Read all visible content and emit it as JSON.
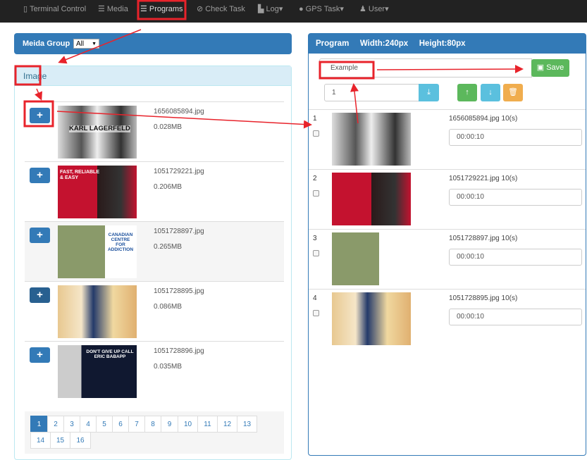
{
  "nav": {
    "items": [
      {
        "label": "Terminal Control",
        "icon": "mobile-icon"
      },
      {
        "label": "Media",
        "icon": "list-icon"
      },
      {
        "label": "Programs",
        "icon": "list-icon"
      },
      {
        "label": "Check Task",
        "icon": "check-circle-icon"
      },
      {
        "label": "Log▾",
        "icon": "file-icon"
      },
      {
        "label": "GPS Task▾",
        "icon": "globe-icon"
      },
      {
        "label": "User▾",
        "icon": "user-icon"
      }
    ]
  },
  "media": {
    "group_label": "Meida Group",
    "group_value": "All",
    "panel_title": "Image",
    "items": [
      {
        "file": "1656085894.jpg",
        "size": "0.028MB",
        "thumb_text": "KARL LAGERFELD"
      },
      {
        "file": "1051729221.jpg",
        "size": "0.206MB",
        "thumb_text": "FAST, RELIABLE & EASY"
      },
      {
        "file": "1051728897.jpg",
        "size": "0.265MB",
        "thumb_text": "CANADIAN CENTRE FOR ADDICTION"
      },
      {
        "file": "1051728895.jpg",
        "size": "0.086MB"
      },
      {
        "file": "1051728896.jpg",
        "size": "0.035MB",
        "thumb_text": "DON'T GIVE UP CALL ERIC BABAPP"
      }
    ],
    "pages": [
      "1",
      "2",
      "3",
      "4",
      "5",
      "6",
      "7",
      "8",
      "9",
      "10",
      "11",
      "12",
      "13",
      "14",
      "15",
      "16"
    ],
    "current_page": "1"
  },
  "program": {
    "title": "Program",
    "width": "Width:240px",
    "height": "Height:80px",
    "name_value": "Example",
    "save_label": "Save",
    "index_value": "1",
    "items": [
      {
        "num": "1",
        "label": "1656085894.jpg 10(s)",
        "time": "00:00:10"
      },
      {
        "num": "2",
        "label": "1051729221.jpg 10(s)",
        "time": "00:00:10"
      },
      {
        "num": "3",
        "label": "1051728897.jpg 10(s)",
        "time": "00:00:10"
      },
      {
        "num": "4",
        "label": "1051728895.jpg 10(s)",
        "time": "00:00:10"
      }
    ]
  },
  "colors": {
    "primary": "#337ab7",
    "success": "#5cb85c",
    "info": "#5bc0de",
    "warning": "#f0ad4e",
    "annotation": "#e8232b"
  }
}
